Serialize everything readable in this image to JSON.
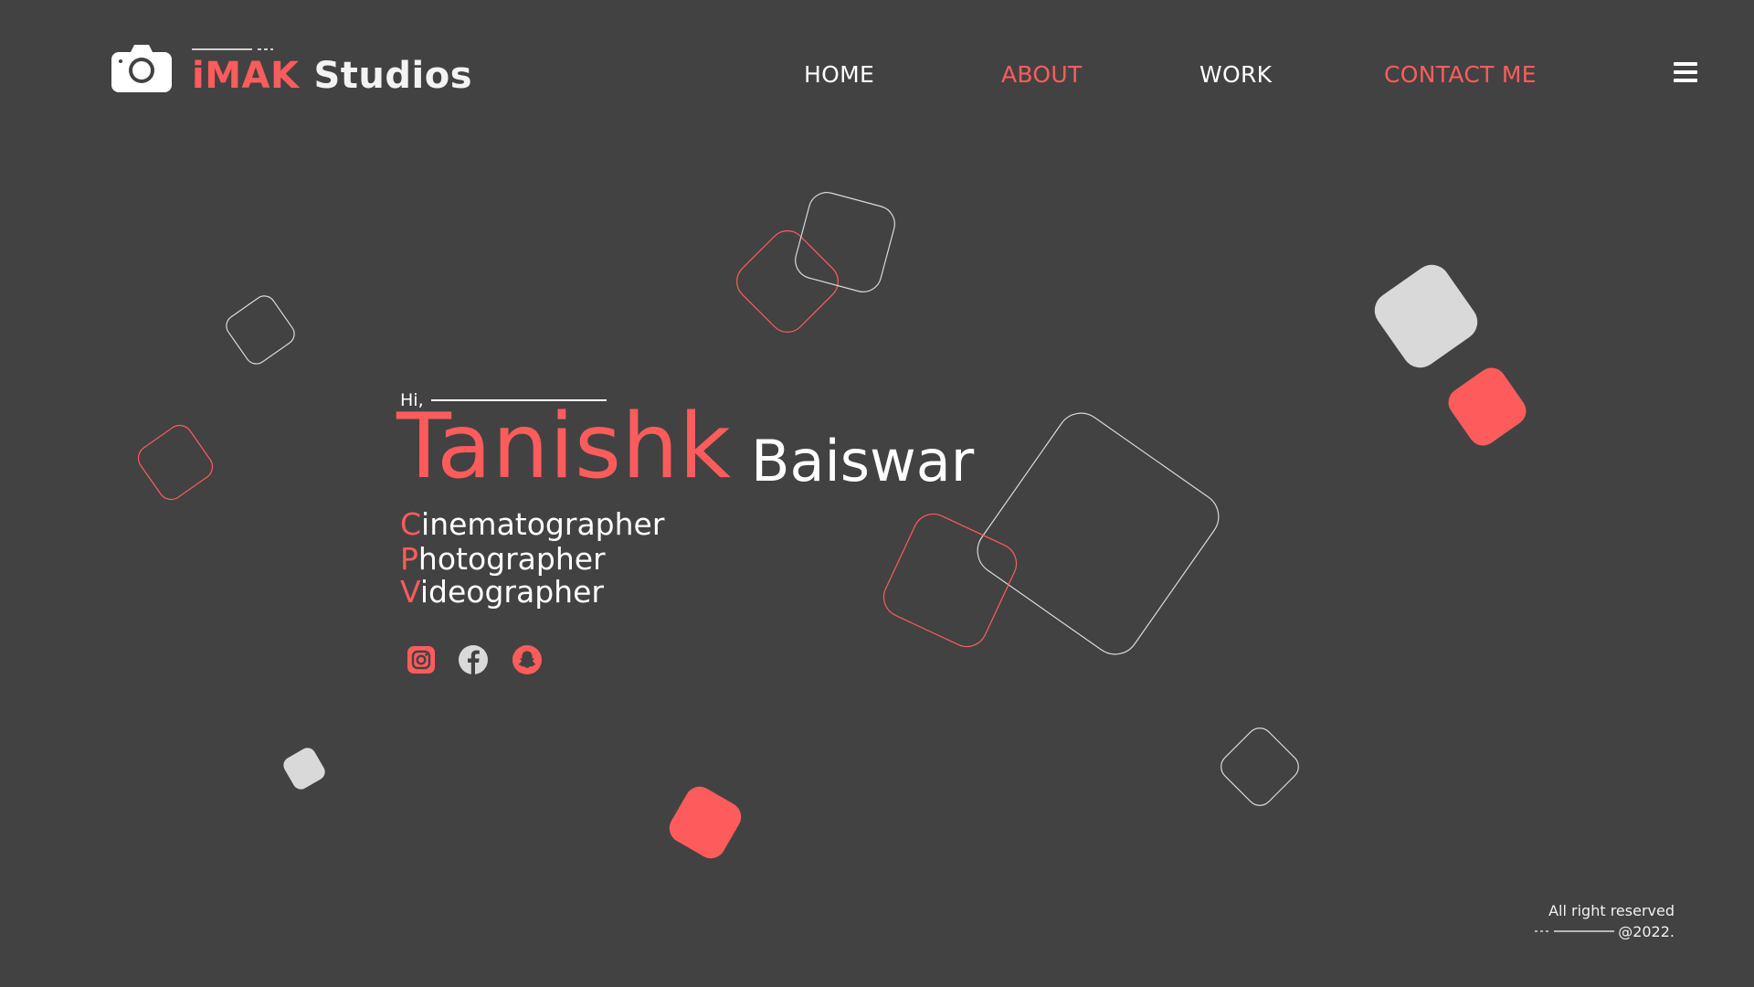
{
  "theme": {
    "accent": "#fe5c5c",
    "background": "#424242",
    "light_shape": "#d9d9d9"
  },
  "header": {
    "logo_icon": "camera-icon",
    "brand": "iMAK",
    "brand_suffix": "Studios",
    "nav": [
      {
        "label": "HOME"
      },
      {
        "label": "ABOUT"
      },
      {
        "label": "WORK"
      },
      {
        "label": "CONTACT ME"
      }
    ],
    "menu_icon": "hamburger-menu-icon"
  },
  "hero": {
    "greeting": "Hi,",
    "first_name": "Tanishk",
    "last_name": "Baiswar",
    "roles": [
      {
        "initial": "C",
        "rest": "inematographer"
      },
      {
        "initial": "P",
        "rest": "hotographer"
      },
      {
        "initial": "V",
        "rest": "ideographer"
      }
    ],
    "social": [
      "instagram-icon",
      "facebook-icon",
      "snapchat-icon"
    ]
  },
  "footer": {
    "rights": "All right reserved",
    "year": "@2022."
  }
}
